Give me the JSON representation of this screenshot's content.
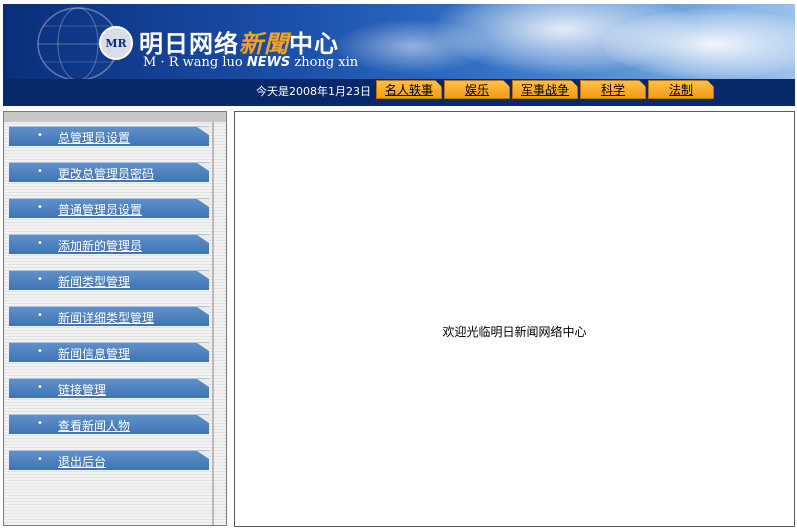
{
  "banner": {
    "logo_text": "MR",
    "title_part1": "明日网络",
    "title_highlight": "新聞",
    "title_part2": "中心",
    "sub_prefix": "M · R wang luo ",
    "sub_news": "NEWS",
    "sub_suffix": " zhong xin",
    "date_text": "今天是2008年1月23日"
  },
  "nav": {
    "items": [
      "名人轶事",
      "娱乐",
      "军事战争",
      "科学",
      "法制"
    ]
  },
  "sidebar": {
    "items": [
      {
        "label": "总管理员设置"
      },
      {
        "label": "更改总管理员密码"
      },
      {
        "label": "普通管理员设置"
      },
      {
        "label": "添加新的管理员"
      },
      {
        "label": "新闻类型管理"
      },
      {
        "label": "新闻详细类型管理"
      },
      {
        "label": "新闻信息管理"
      },
      {
        "label": "链接管理"
      },
      {
        "label": "查看新闻人物"
      },
      {
        "label": "退出后台"
      }
    ]
  },
  "main": {
    "welcome": "欢迎光临明日新闻网络中心"
  },
  "colors": {
    "banner_dark": "#0a2f7a",
    "nav_button": "#f39c12",
    "menu_blue": "#3f73b4"
  }
}
